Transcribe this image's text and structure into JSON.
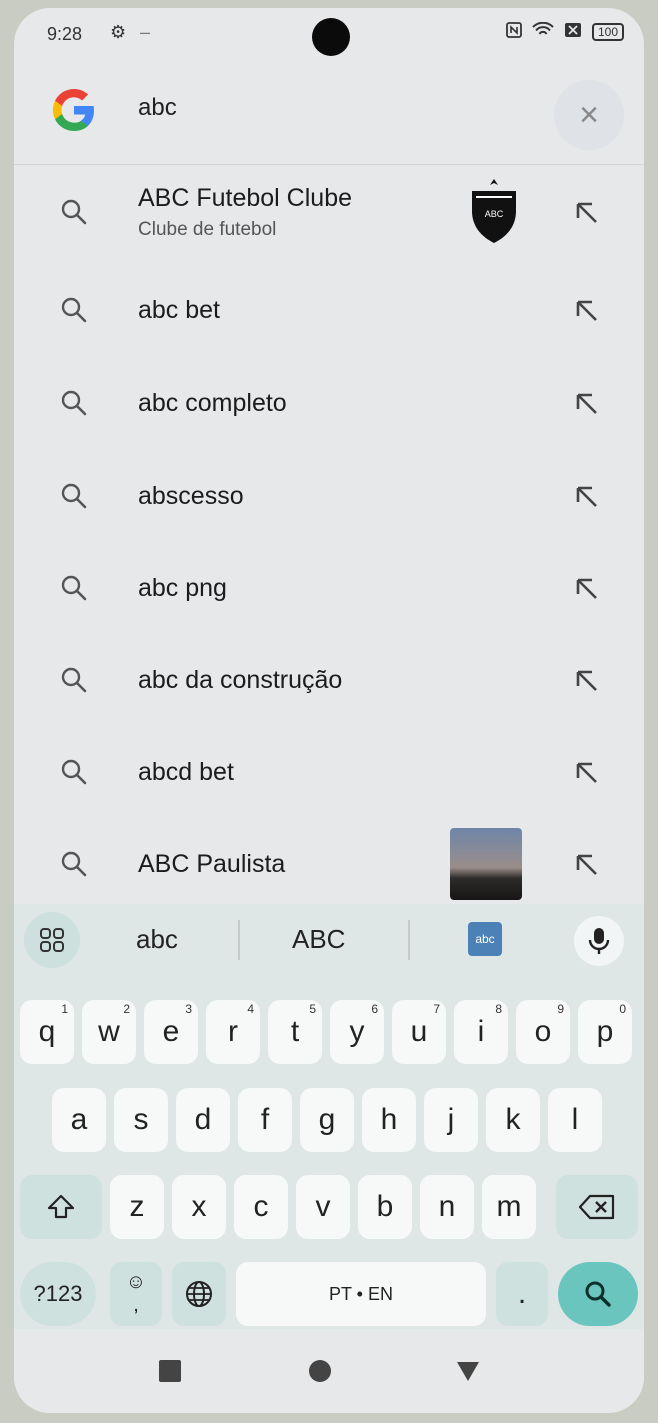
{
  "status_bar": {
    "time": "9:28",
    "battery": "100"
  },
  "search": {
    "query": "abc",
    "clear_label": "×"
  },
  "suggestions": [
    {
      "title": "ABC Futebol Clube",
      "subtitle": "Clube de futebol",
      "thumb": "crest"
    },
    {
      "title": "abc bet"
    },
    {
      "title": "abc completo"
    },
    {
      "title": "abscesso"
    },
    {
      "title": "abc png"
    },
    {
      "title": "abc da construção"
    },
    {
      "title": "abcd bet"
    },
    {
      "title": "ABC Paulista",
      "thumb": "city"
    }
  ],
  "keyboard": {
    "suggestions": [
      "abc",
      "ABC"
    ],
    "sticker_label": "abc",
    "row1": [
      {
        "k": "q",
        "h": "1"
      },
      {
        "k": "w",
        "h": "2"
      },
      {
        "k": "e",
        "h": "3"
      },
      {
        "k": "r",
        "h": "4"
      },
      {
        "k": "t",
        "h": "5"
      },
      {
        "k": "y",
        "h": "6"
      },
      {
        "k": "u",
        "h": "7"
      },
      {
        "k": "i",
        "h": "8"
      },
      {
        "k": "o",
        "h": "9"
      },
      {
        "k": "p",
        "h": "0"
      }
    ],
    "row2": [
      "a",
      "s",
      "d",
      "f",
      "g",
      "h",
      "j",
      "k",
      "l"
    ],
    "row3": [
      "z",
      "x",
      "c",
      "v",
      "b",
      "n",
      "m"
    ],
    "symbols_label": "?123",
    "emoji_sub": ",",
    "space_label": "PT • EN",
    "period_label": "."
  }
}
